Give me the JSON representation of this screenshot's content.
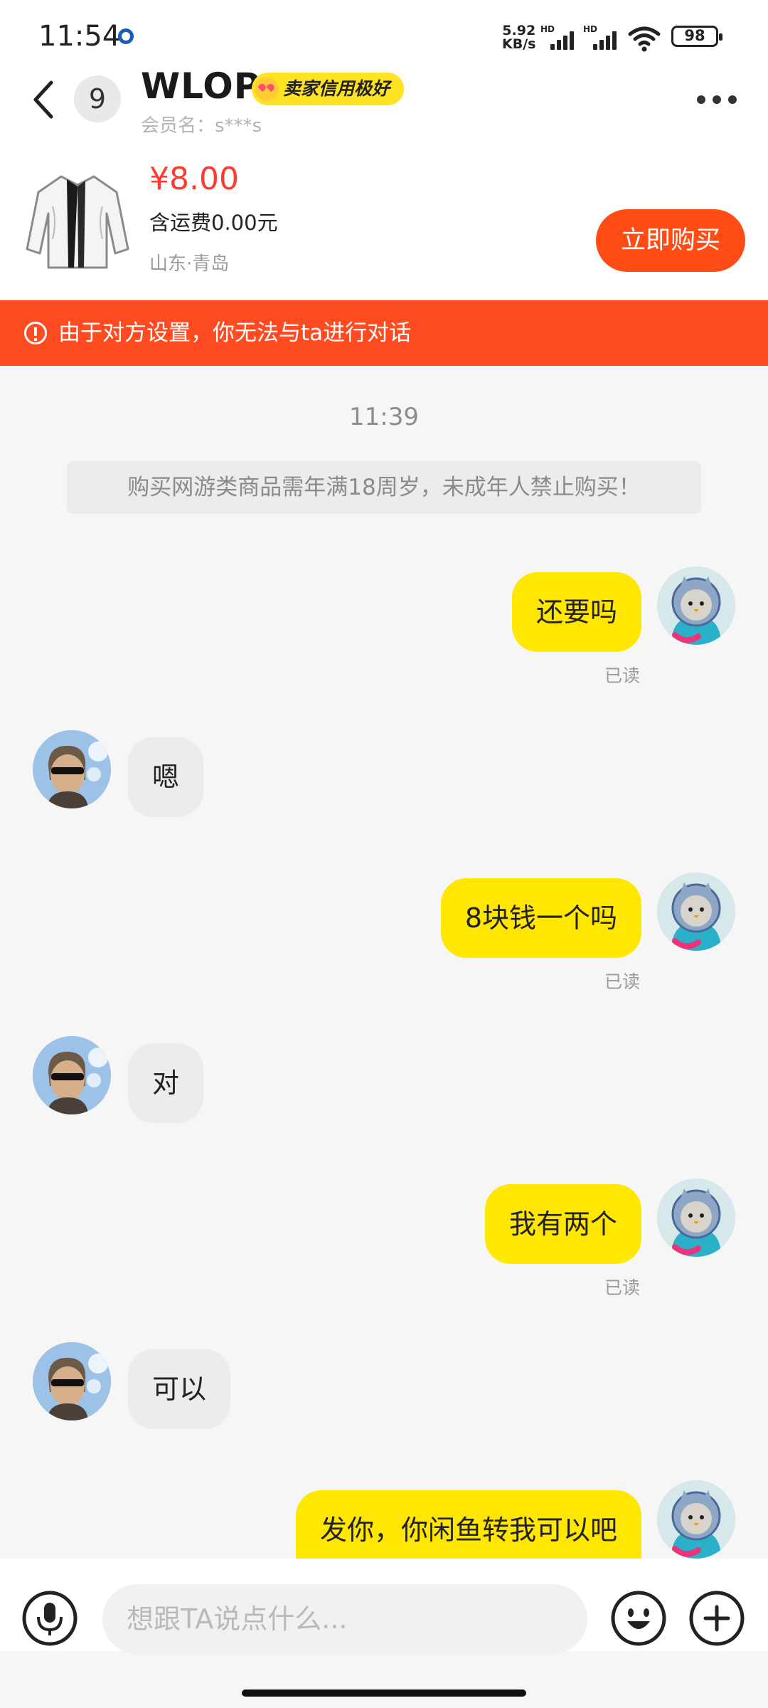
{
  "status_bar": {
    "time": "11:54",
    "net_speed_value": "5.92",
    "net_speed_unit": "KB/s",
    "signal_label": "HD",
    "battery": "98"
  },
  "header": {
    "unread_count": "9",
    "seller_name": "WLOP",
    "credit_badge": "卖家信用极好",
    "member_name": "会员名：s***s"
  },
  "product": {
    "price": "¥8.00",
    "shipping": "含运费0.00元",
    "location": "山东·青岛",
    "buy_label": "立即购买"
  },
  "warning": {
    "text": "由于对方设置，你无法与ta进行对话"
  },
  "chat": {
    "time": "11:39",
    "notice": "购买网游类商品需年满18周岁，未成年人禁止购买！",
    "messages": [
      {
        "direction": "out",
        "text": "还要吗",
        "status": "已读"
      },
      {
        "direction": "in",
        "text": "嗯"
      },
      {
        "direction": "out",
        "text": "8块钱一个吗",
        "status": "已读"
      },
      {
        "direction": "in",
        "text": "对"
      },
      {
        "direction": "out",
        "text": "我有两个",
        "status": "已读"
      },
      {
        "direction": "in",
        "text": "可以"
      },
      {
        "direction": "out",
        "text": "发你，你闲鱼转我可以吧"
      }
    ]
  },
  "input": {
    "placeholder": "想跟TA说点什么..."
  },
  "icons": {
    "back": "chevron-left-icon",
    "more": "more-horizontal-icon",
    "voice": "microphone-icon",
    "emoji": "emoji-icon",
    "plus": "plus-icon",
    "warning": "alert-circle-icon"
  },
  "colors": {
    "accent_orange": "#ff4b14",
    "outgoing_bubble": "#ffe700",
    "price_red": "#ff3b30",
    "badge_yellow": "#ffe321"
  }
}
